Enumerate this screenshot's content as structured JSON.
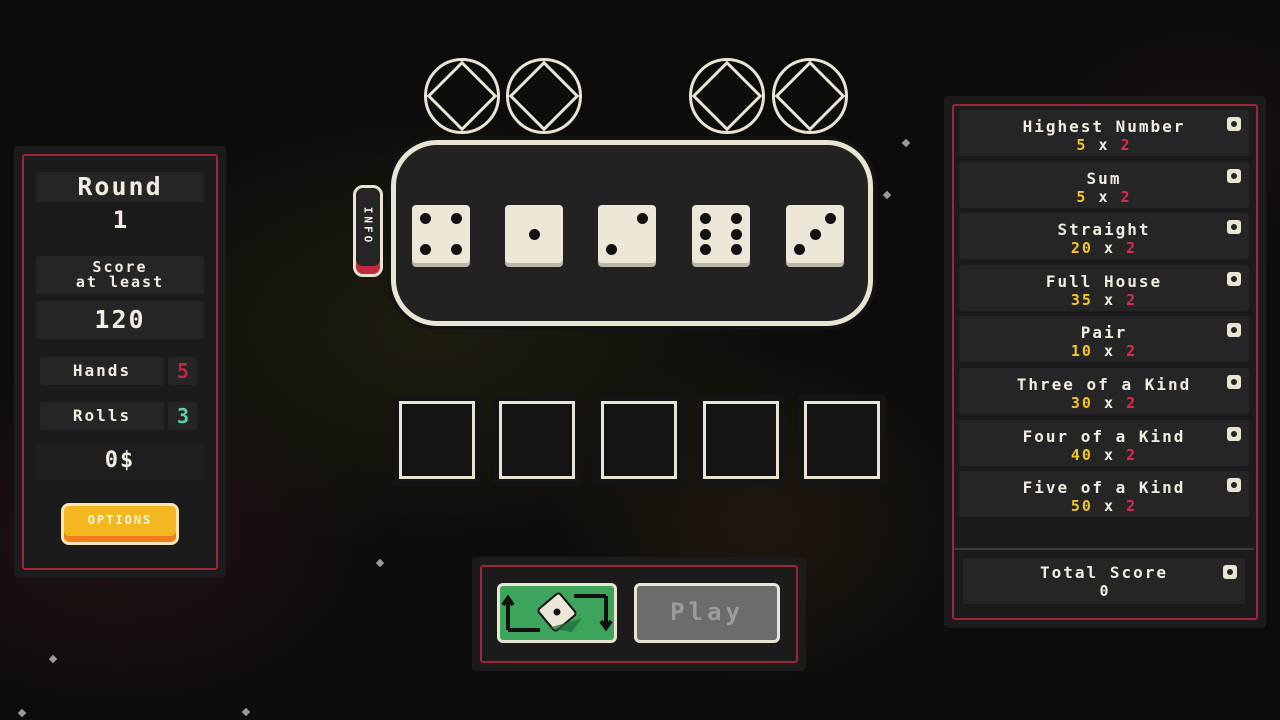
{
  "left_panel": {
    "round_label": "Round",
    "round_value": "1",
    "score_label_line1": "Score",
    "score_label_line2": "at least",
    "score_value": "120",
    "hands_label": "Hands",
    "hands_value": "5",
    "rolls_label": "Rolls",
    "rolls_value": "3",
    "money": "0$",
    "options_label": "OPTIONS"
  },
  "info_tab_label": "INFO",
  "dice_values": [
    4,
    1,
    2,
    6,
    3
  ],
  "empty_slot_count": 5,
  "action_panel": {
    "reroll_icon": "reroll-dice-icon",
    "play_label": "Play"
  },
  "hands": [
    {
      "name": "Highest Number",
      "base": "5",
      "mult": "2"
    },
    {
      "name": "Sum",
      "base": "5",
      "mult": "2"
    },
    {
      "name": "Straight",
      "base": "20",
      "mult": "2"
    },
    {
      "name": "Full House",
      "base": "35",
      "mult": "2"
    },
    {
      "name": "Pair",
      "base": "10",
      "mult": "2"
    },
    {
      "name": "Three of a Kind",
      "base": "30",
      "mult": "2"
    },
    {
      "name": "Four of a Kind",
      "base": "40",
      "mult": "2"
    },
    {
      "name": "Five of a Kind",
      "base": "50",
      "mult": "2"
    }
  ],
  "times_sign": "x",
  "total": {
    "label": "Total Score",
    "value": "0"
  },
  "colors": {
    "accent_red": "#9c2537",
    "hands_red": "#c0283d",
    "rolls_green": "#5ed2a0",
    "base_yellow": "#f3c629",
    "mult_red": "#e0294a",
    "options_yellow": "#f3b81f",
    "reroll_green": "#3da55b"
  }
}
